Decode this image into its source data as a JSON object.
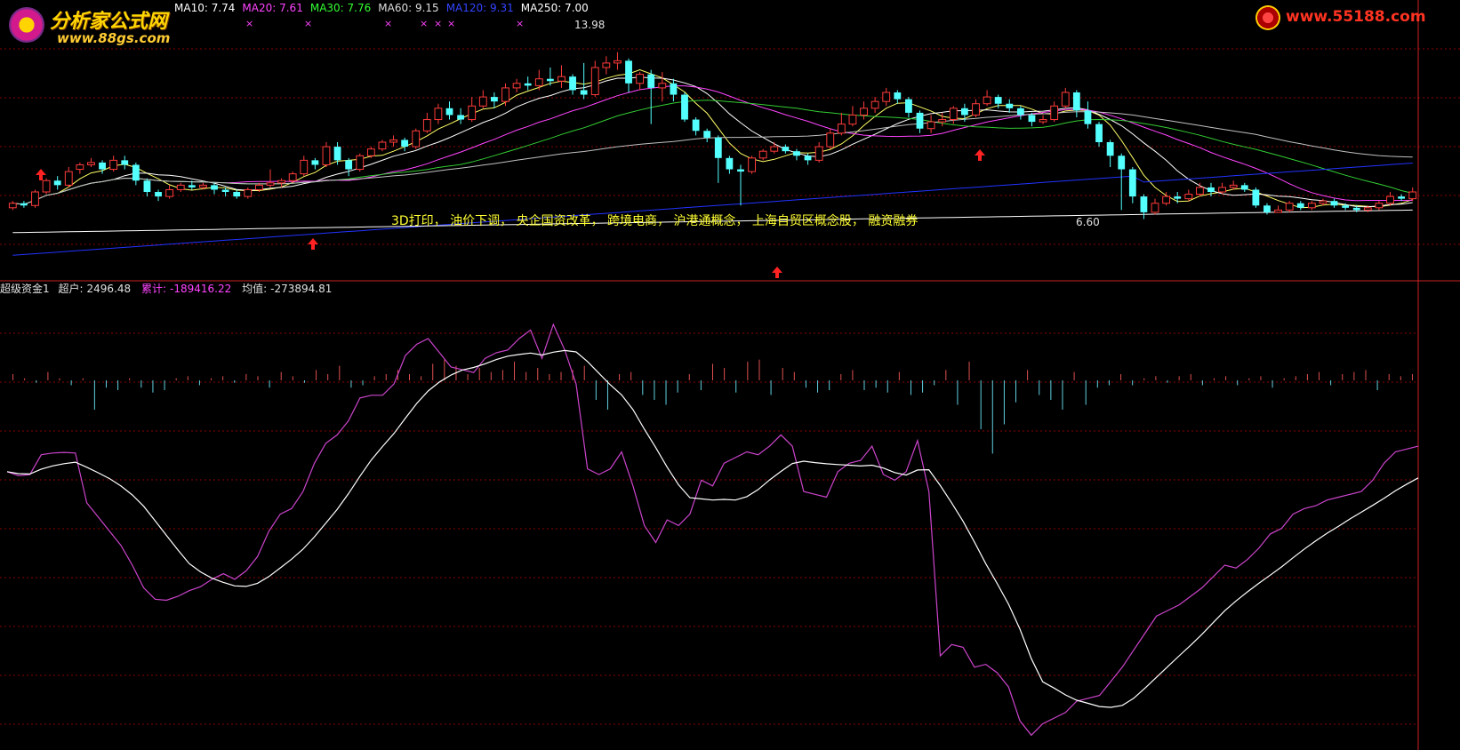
{
  "logo_left": {
    "title": "分析家公式网",
    "url": "www.88gs.com"
  },
  "logo_right": {
    "url": "www.55188.com"
  },
  "price_legend": [
    {
      "label": "MA10",
      "value": "7.74",
      "color": "#ffffff"
    },
    {
      "label": "MA20",
      "value": "7.61",
      "color": "#ff44ff"
    },
    {
      "label": "MA30",
      "value": "7.76",
      "color": "#33ff33"
    },
    {
      "label": "MA60",
      "value": "9.15",
      "color": "#dddddd"
    },
    {
      "label": "MA120",
      "value": "9.31",
      "color": "#3344ff"
    },
    {
      "label": "MA250",
      "value": "7.00",
      "color": "#ffffff"
    }
  ],
  "indicator_legend": {
    "name": "超级资金1",
    "chaohu_label": "超户",
    "chaohu_value": "2496.48",
    "leiji_label": "累计",
    "leiji_value": "-189416.22",
    "junzhi_label": "均值",
    "junzhi_value": "-273894.81"
  },
  "annotation_text": "3D打印， 油价下调， 央企国资改革， 跨境电商， 沪港通概念， 上海自贸区概念股， 融资融券",
  "high_label": "13.98",
  "low_label": "6.60",
  "colors": {
    "up_candle": "#ff3b3b",
    "down_candle": "#54ffff",
    "ma_yellow": "#ffff66",
    "ma_magenta": "#ff44ff",
    "ma_green": "#33cc33",
    "ma_gray": "#c0c0c0",
    "ma_blue": "#2233ff",
    "grid": "#8b0000",
    "indicator_line": "#cc44cc",
    "indicator_avg": "#ffffff"
  },
  "chart_data": {
    "type": "candlestick_with_indicator",
    "price_range": [
      4.5,
      15.5
    ],
    "candles": [
      [
        7.1,
        7.3,
        7.0,
        7.4
      ],
      [
        7.3,
        7.2,
        7.1,
        7.4
      ],
      [
        7.2,
        7.8,
        7.1,
        7.9
      ],
      [
        7.8,
        8.3,
        7.7,
        8.4
      ],
      [
        8.3,
        8.1,
        7.9,
        8.5
      ],
      [
        8.1,
        8.7,
        8.0,
        8.9
      ],
      [
        8.8,
        9.0,
        8.6,
        9.1
      ],
      [
        9.0,
        9.1,
        8.9,
        9.3
      ],
      [
        9.1,
        8.8,
        8.6,
        9.2
      ],
      [
        8.8,
        9.2,
        8.7,
        9.4
      ],
      [
        9.2,
        9.0,
        8.8,
        9.4
      ],
      [
        9.0,
        8.3,
        8.1,
        9.1
      ],
      [
        8.3,
        7.8,
        7.6,
        8.4
      ],
      [
        7.8,
        7.6,
        7.4,
        7.9
      ],
      [
        7.6,
        7.9,
        7.5,
        8.1
      ],
      [
        7.9,
        8.1,
        7.8,
        8.2
      ],
      [
        8.1,
        8.0,
        7.9,
        8.3
      ],
      [
        8.0,
        8.1,
        7.9,
        8.2
      ],
      [
        8.1,
        7.9,
        7.7,
        8.2
      ],
      [
        7.9,
        7.8,
        7.6,
        8.0
      ],
      [
        7.8,
        7.6,
        7.5,
        7.9
      ],
      [
        7.6,
        7.9,
        7.5,
        8.0
      ],
      [
        7.9,
        8.1,
        7.8,
        8.2
      ],
      [
        8.1,
        8.2,
        8.0,
        8.8
      ],
      [
        8.2,
        8.3,
        8.0,
        8.4
      ],
      [
        8.3,
        8.6,
        8.2,
        8.7
      ],
      [
        8.6,
        9.2,
        8.5,
        9.4
      ],
      [
        9.2,
        9.0,
        8.8,
        9.3
      ],
      [
        9.0,
        9.8,
        8.9,
        10.0
      ],
      [
        9.8,
        9.2,
        9.0,
        10.0
      ],
      [
        9.2,
        8.8,
        8.5,
        9.3
      ],
      [
        8.8,
        9.4,
        8.7,
        9.5
      ],
      [
        9.4,
        9.7,
        9.3,
        9.8
      ],
      [
        9.7,
        10.0,
        9.6,
        10.1
      ],
      [
        10.0,
        10.1,
        9.8,
        10.3
      ],
      [
        10.1,
        9.8,
        9.6,
        10.2
      ],
      [
        9.8,
        10.5,
        9.7,
        10.6
      ],
      [
        10.5,
        11.0,
        10.4,
        11.3
      ],
      [
        11.0,
        11.5,
        10.8,
        11.7
      ],
      [
        11.5,
        11.2,
        11.0,
        11.8
      ],
      [
        11.2,
        11.0,
        10.8,
        11.5
      ],
      [
        11.0,
        11.6,
        10.9,
        12.0
      ],
      [
        11.6,
        12.0,
        11.5,
        12.3
      ],
      [
        12.0,
        11.8,
        11.5,
        12.2
      ],
      [
        11.8,
        12.4,
        11.6,
        12.6
      ],
      [
        12.4,
        12.6,
        12.2,
        12.8
      ],
      [
        12.6,
        12.5,
        12.3,
        12.9
      ],
      [
        12.5,
        12.8,
        12.3,
        13.2
      ],
      [
        12.8,
        12.7,
        12.5,
        13.3
      ],
      [
        12.7,
        12.9,
        12.4,
        13.4
      ],
      [
        12.9,
        12.3,
        12.1,
        13.0
      ],
      [
        12.3,
        12.1,
        11.9,
        13.5
      ],
      [
        12.1,
        13.3,
        12.0,
        13.6
      ],
      [
        13.3,
        13.5,
        13.0,
        13.8
      ],
      [
        13.5,
        13.6,
        13.2,
        13.98
      ],
      [
        13.6,
        12.6,
        12.2,
        13.7
      ],
      [
        12.6,
        13.0,
        12.3,
        13.1
      ],
      [
        13.0,
        12.4,
        10.8,
        13.2
      ],
      [
        12.4,
        12.6,
        11.8,
        13.1
      ],
      [
        12.6,
        12.1,
        11.8,
        12.8
      ],
      [
        12.1,
        11.0,
        10.9,
        12.2
      ],
      [
        11.0,
        10.5,
        10.3,
        11.1
      ],
      [
        10.5,
        10.2,
        10.0,
        10.6
      ],
      [
        10.2,
        9.3,
        8.2,
        10.3
      ],
      [
        9.3,
        8.8,
        8.6,
        9.4
      ],
      [
        8.8,
        8.7,
        7.2,
        9.0
      ],
      [
        8.7,
        9.3,
        8.6,
        9.4
      ],
      [
        9.3,
        9.6,
        9.2,
        9.7
      ],
      [
        9.6,
        9.8,
        9.5,
        10.0
      ],
      [
        9.8,
        9.6,
        9.5,
        9.9
      ],
      [
        9.6,
        9.4,
        9.2,
        9.7
      ],
      [
        9.4,
        9.2,
        9.0,
        9.5
      ],
      [
        9.2,
        9.8,
        9.1,
        10.0
      ],
      [
        9.8,
        10.4,
        9.7,
        10.6
      ],
      [
        10.4,
        10.8,
        10.3,
        11.3
      ],
      [
        10.8,
        11.2,
        10.7,
        11.6
      ],
      [
        11.2,
        11.5,
        11.0,
        11.8
      ],
      [
        11.5,
        11.8,
        11.3,
        12.0
      ],
      [
        11.8,
        12.2,
        11.6,
        12.4
      ],
      [
        12.2,
        11.9,
        11.7,
        12.3
      ],
      [
        11.9,
        11.3,
        11.1,
        12.0
      ],
      [
        11.3,
        10.6,
        10.4,
        11.4
      ],
      [
        10.6,
        10.9,
        10.4,
        11.2
      ],
      [
        10.9,
        11.0,
        10.7,
        11.3
      ],
      [
        11.0,
        11.5,
        10.8,
        11.6
      ],
      [
        11.5,
        11.2,
        10.9,
        11.7
      ],
      [
        11.2,
        11.7,
        11.1,
        11.9
      ],
      [
        11.7,
        12.0,
        11.6,
        12.3
      ],
      [
        12.0,
        11.7,
        11.5,
        12.1
      ],
      [
        11.7,
        11.5,
        11.3,
        11.9
      ],
      [
        11.5,
        11.2,
        11.0,
        11.6
      ],
      [
        11.2,
        10.9,
        10.7,
        11.3
      ],
      [
        10.9,
        11.0,
        10.8,
        11.2
      ],
      [
        11.0,
        11.6,
        10.9,
        11.8
      ],
      [
        11.6,
        12.2,
        11.5,
        12.4
      ],
      [
        12.2,
        11.4,
        11.1,
        12.3
      ],
      [
        11.4,
        10.8,
        10.6,
        11.8
      ],
      [
        10.8,
        10.0,
        9.8,
        10.9
      ],
      [
        10.0,
        9.4,
        8.9,
        10.1
      ],
      [
        9.4,
        8.8,
        7.0,
        9.5
      ],
      [
        8.8,
        7.6,
        7.3,
        8.9
      ],
      [
        7.6,
        6.9,
        6.6,
        7.7
      ],
      [
        6.9,
        7.3,
        6.8,
        7.5
      ],
      [
        7.3,
        7.6,
        7.2,
        7.8
      ],
      [
        7.6,
        7.5,
        7.3,
        7.8
      ],
      [
        7.5,
        7.7,
        7.4,
        7.9
      ],
      [
        7.7,
        8.0,
        7.6,
        8.2
      ],
      [
        8.0,
        7.8,
        7.6,
        8.2
      ],
      [
        7.8,
        8.0,
        7.7,
        8.2
      ],
      [
        8.0,
        8.1,
        7.9,
        8.3
      ],
      [
        8.1,
        7.9,
        7.8,
        8.2
      ],
      [
        7.9,
        7.2,
        7.1,
        8.0
      ],
      [
        7.2,
        6.9,
        6.8,
        7.3
      ],
      [
        6.9,
        7.0,
        6.9,
        7.2
      ],
      [
        7.0,
        7.3,
        6.9,
        7.4
      ],
      [
        7.3,
        7.1,
        7.0,
        7.4
      ],
      [
        7.1,
        7.3,
        7.0,
        7.4
      ],
      [
        7.3,
        7.4,
        7.2,
        7.5
      ],
      [
        7.4,
        7.2,
        7.1,
        7.5
      ],
      [
        7.2,
        7.1,
        7.0,
        7.3
      ],
      [
        7.1,
        7.0,
        6.9,
        7.2
      ],
      [
        7.0,
        7.1,
        6.9,
        7.2
      ],
      [
        7.1,
        7.3,
        7.0,
        7.4
      ],
      [
        7.3,
        7.6,
        7.2,
        7.8
      ],
      [
        7.6,
        7.5,
        7.4,
        7.7
      ],
      [
        7.5,
        7.8,
        7.4,
        8.0
      ]
    ],
    "indicator": [
      -0.55,
      -0.62,
      -0.6,
      -0.25,
      -0.22,
      -0.21,
      -0.22,
      -1.1,
      -1.35,
      -1.6,
      -1.85,
      -2.2,
      -2.6,
      -2.8,
      -2.82,
      -2.75,
      -2.65,
      -2.58,
      -2.45,
      -2.35,
      -2.45,
      -2.3,
      -2.05,
      -1.6,
      -1.3,
      -1.2,
      -0.9,
      -0.4,
      -0.05,
      0.1,
      0.35,
      0.75,
      0.8,
      0.8,
      1.0,
      1.5,
      1.7,
      1.8,
      1.55,
      1.3,
      1.25,
      1.2,
      1.45,
      1.55,
      1.6,
      1.8,
      1.95,
      1.45,
      2.05,
      1.6,
      1.0,
      -0.5,
      -0.6,
      -0.5,
      -0.2,
      -0.8,
      -1.5,
      -1.8,
      -1.4,
      -1.5,
      -1.3,
      -0.7,
      -0.8,
      -0.4,
      -0.3,
      -0.2,
      -0.25,
      -0.1,
      0.1,
      -0.1,
      -0.9,
      -0.95,
      -1.0,
      -0.55,
      -0.4,
      -0.35,
      -0.1,
      -0.6,
      -0.7,
      -0.55,
      0.0,
      -0.9,
      -3.8,
      -3.6,
      -3.65,
      -4.0,
      -3.95,
      -4.1,
      -4.35,
      -4.95,
      -5.2,
      -5.0,
      -4.9,
      -4.8,
      -4.6,
      -4.55,
      -4.5,
      -4.25,
      -4.0,
      -3.7,
      -3.4,
      -3.1,
      -3.0,
      -2.9,
      -2.75,
      -2.6,
      -2.4,
      -2.2,
      -2.25,
      -2.1,
      -1.9,
      -1.65,
      -1.55,
      -1.3,
      -1.2,
      -1.15,
      -1.05,
      -1.0,
      -0.95,
      -0.9,
      -0.7,
      -0.4,
      -0.2,
      -0.15,
      -0.1
    ],
    "indicator_range": [
      -5.4,
      2.6
    ],
    "bars": [
      0.3,
      0.1,
      -0.1,
      0.4,
      0.1,
      -0.2,
      0.1,
      -1.2,
      -0.3,
      -0.4,
      0.1,
      -0.3,
      -0.5,
      -0.4,
      0.1,
      0.2,
      -0.2,
      0.1,
      0.2,
      -0.1,
      0.3,
      0.2,
      -0.3,
      0.4,
      0.2,
      -0.1,
      0.5,
      0.3,
      0.7,
      -0.3,
      -0.2,
      0.2,
      0.3,
      0.5,
      0.3,
      0.2,
      0.8,
      1.0,
      0.7,
      0.3,
      0.6,
      0.4,
      0.5,
      0.9,
      0.4,
      0.6,
      0.3,
      0.4,
      0.5,
      0.7,
      -0.8,
      -1.2,
      0.3,
      0.4,
      -0.6,
      -0.8,
      -1.0,
      -0.5,
      0.3,
      -0.4,
      0.8,
      0.6,
      -0.5,
      0.9,
      1.0,
      -0.6,
      0.6,
      0.4,
      -0.3,
      -0.5,
      -0.4,
      0.3,
      0.5,
      -0.4,
      -0.3,
      -0.5,
      0.4,
      -0.6,
      -0.5,
      -0.2,
      0.5,
      -1.0,
      0.9,
      -2.0,
      -3.0,
      -1.8,
      -0.9,
      0.5,
      -0.6,
      -0.8,
      -1.2,
      0.4,
      -1.0,
      -0.3,
      -0.2,
      0.3,
      -0.2,
      0.1,
      0.2,
      -0.1,
      0.2,
      0.3,
      -0.2,
      0.1,
      0.2,
      -0.2,
      0.1,
      0.2,
      -0.3,
      0.1,
      0.2,
      0.3,
      0.4,
      -0.2,
      0.3,
      0.4,
      0.5,
      -0.4,
      0.3,
      0.2,
      0.3
    ],
    "bar_range": [
      -3.2,
      1.2
    ]
  }
}
